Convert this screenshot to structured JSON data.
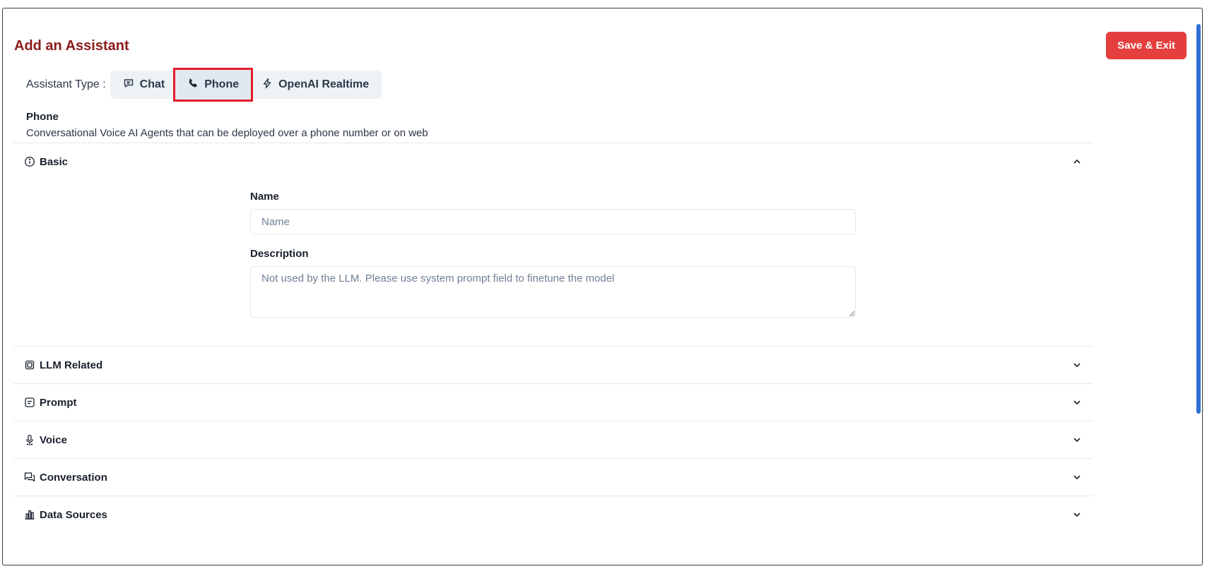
{
  "header": {
    "title": "Add an Assistant",
    "save_label": "Save & Exit"
  },
  "assistant_type": {
    "label": "Assistant Type :",
    "options": [
      {
        "label": "Chat",
        "icon": "chat-bubble-icon"
      },
      {
        "label": "Phone",
        "icon": "phone-icon"
      },
      {
        "label": "OpenAI Realtime",
        "icon": "lightning-icon"
      }
    ],
    "selected": "Phone"
  },
  "type_info": {
    "title": "Phone",
    "description": "Conversational Voice AI Agents that can be deployed over a phone number or on web"
  },
  "sections": [
    {
      "label": "Basic",
      "icon": "info-icon",
      "expanded": true
    },
    {
      "label": "LLM Related",
      "icon": "chip-icon",
      "expanded": false
    },
    {
      "label": "Prompt",
      "icon": "prompt-icon",
      "expanded": false
    },
    {
      "label": "Voice",
      "icon": "microphone-icon",
      "expanded": false
    },
    {
      "label": "Conversation",
      "icon": "conversation-icon",
      "expanded": false
    },
    {
      "label": "Data Sources",
      "icon": "data-sources-icon",
      "expanded": false
    }
  ],
  "basic": {
    "name_label": "Name",
    "name_placeholder": "Name",
    "name_value": "",
    "description_label": "Description",
    "description_placeholder": "Not used by the LLM. Please use system prompt field to finetune the model",
    "description_value": ""
  },
  "colors": {
    "title": "#8b1a1a",
    "save_button": "#e53e3e",
    "highlight": "#e11d2a",
    "scrollbar": "#2f6fd6"
  }
}
